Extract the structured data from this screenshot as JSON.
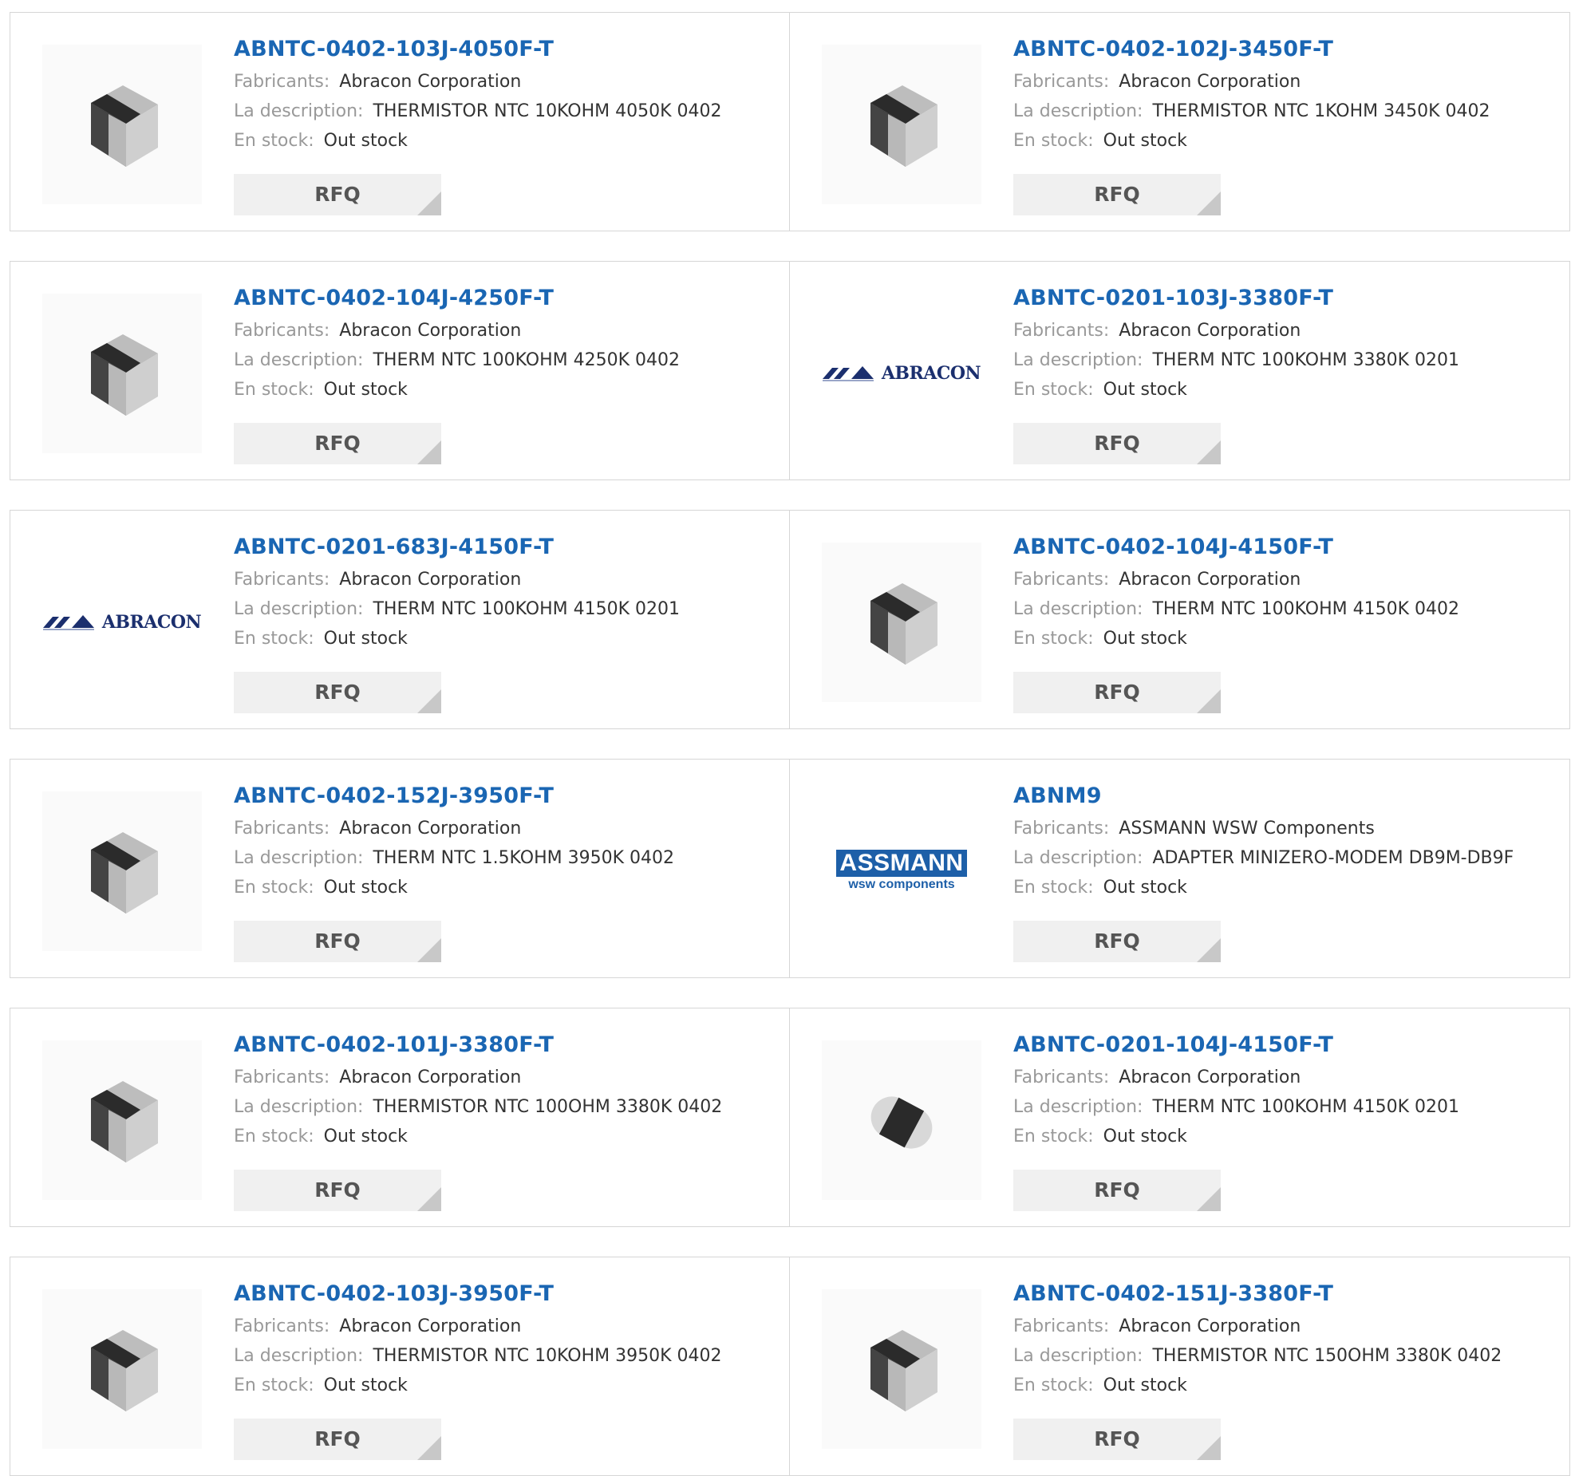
{
  "labels": {
    "manufacturer": "Fabricants:",
    "description": "La description:",
    "stock": "En stock:",
    "rfq": "RFQ"
  },
  "colors": {
    "part_link": "#1a66b3",
    "label": "#999999",
    "button_bg": "#f0f0f0"
  },
  "products": [
    {
      "part": "ABNTC-0402-103J-4050F-T",
      "manufacturer": "Abracon Corporation",
      "description": "THERMISTOR NTC 10KOHM 4050K 0402",
      "stock": "Out stock",
      "image": "chip-icon"
    },
    {
      "part": "ABNTC-0402-102J-3450F-T",
      "manufacturer": "Abracon Corporation",
      "description": "THERMISTOR NTC 1KOHM 3450K 0402",
      "stock": "Out stock",
      "image": "chip-icon"
    },
    {
      "part": "ABNTC-0402-104J-4250F-T",
      "manufacturer": "Abracon Corporation",
      "description": "THERM NTC 100KOHM 4250K 0402",
      "stock": "Out stock",
      "image": "chip-icon"
    },
    {
      "part": "ABNTC-0201-103J-3380F-T",
      "manufacturer": "Abracon Corporation",
      "description": "THERM NTC 100KOHM 3380K 0201",
      "stock": "Out stock",
      "image": "abracon-logo",
      "logo_text": "ABRACON"
    },
    {
      "part": "ABNTC-0201-683J-4150F-T",
      "manufacturer": "Abracon Corporation",
      "description": "THERM NTC 100KOHM 4150K 0201",
      "stock": "Out stock",
      "image": "abracon-logo",
      "logo_text": "ABRACON"
    },
    {
      "part": "ABNTC-0402-104J-4150F-T",
      "manufacturer": "Abracon Corporation",
      "description": "THERM NTC 100KOHM 4150K 0402",
      "stock": "Out stock",
      "image": "chip-icon"
    },
    {
      "part": "ABNTC-0402-152J-3950F-T",
      "manufacturer": "Abracon Corporation",
      "description": "THERM NTC 1.5KOHM 3950K 0402",
      "stock": "Out stock",
      "image": "chip-icon"
    },
    {
      "part": "ABNM9",
      "manufacturer": "ASSMANN WSW Components",
      "description": "ADAPTER MINIZERO-MODEM DB9M-DB9F",
      "stock": "Out stock",
      "image": "assmann-logo",
      "logo_text": "ASSMANN",
      "logo_subtext": "wsw components"
    },
    {
      "part": "ABNTC-0402-101J-3380F-T",
      "manufacturer": "Abracon Corporation",
      "description": "THERMISTOR NTC 100OHM 3380K 0402",
      "stock": "Out stock",
      "image": "chip-icon"
    },
    {
      "part": "ABNTC-0201-104J-4150F-T",
      "manufacturer": "Abracon Corporation",
      "description": "THERM NTC 100KOHM 4150K 0201",
      "stock": "Out stock",
      "image": "small-chip-icon"
    },
    {
      "part": "ABNTC-0402-103J-3950F-T",
      "manufacturer": "Abracon Corporation",
      "description": "THERMISTOR NTC 10KOHM 3950K 0402",
      "stock": "Out stock",
      "image": "chip-icon"
    },
    {
      "part": "ABNTC-0402-151J-3380F-T",
      "manufacturer": "Abracon Corporation",
      "description": "THERMISTOR NTC 150OHM 3380K 0402",
      "stock": "Out stock",
      "image": "chip-icon"
    }
  ]
}
